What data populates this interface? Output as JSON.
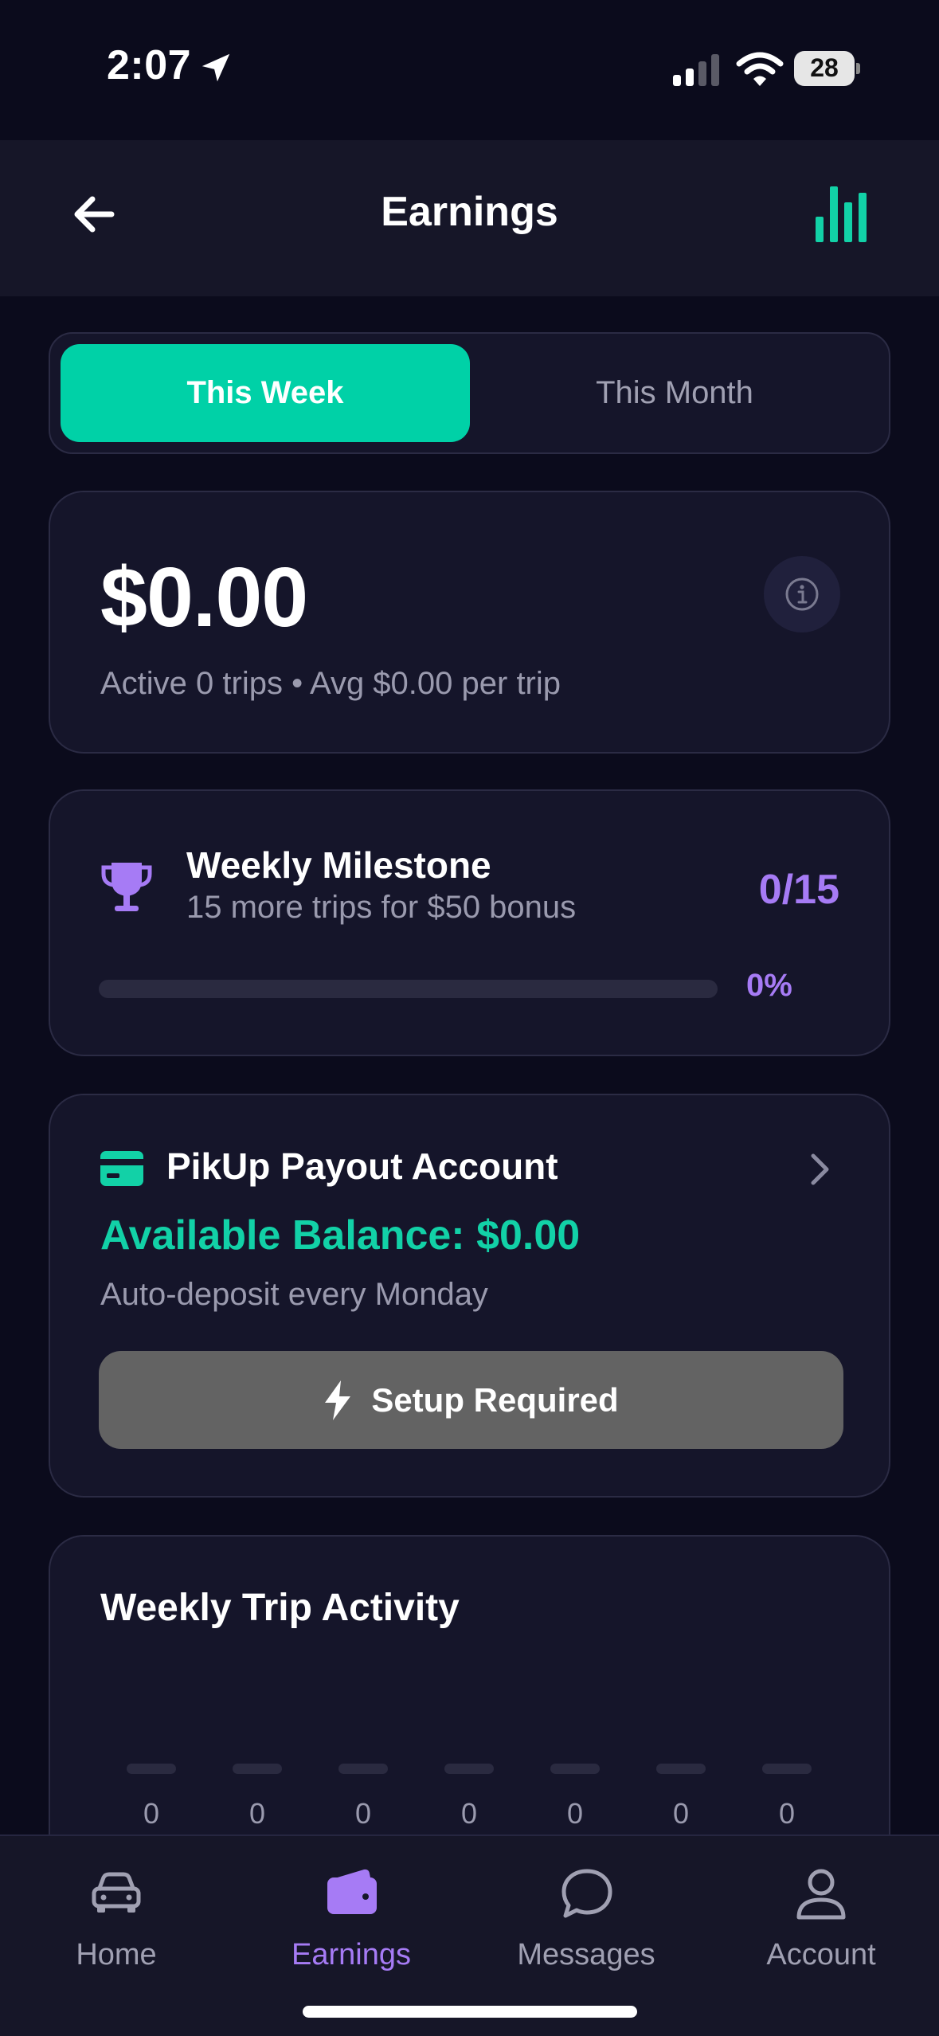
{
  "status_bar": {
    "time": "2:07",
    "battery": "28"
  },
  "header": {
    "title": "Earnings"
  },
  "segments": {
    "active": "This Week",
    "inactive": "This Month"
  },
  "summary": {
    "amount": "$0.00",
    "subtitle": "Active 0 trips • Avg $0.00 per trip"
  },
  "milestone": {
    "title": "Weekly Milestone",
    "subtitle": "15 more trips for $50 bonus",
    "count": "0/15",
    "percent_label": "0%",
    "progress": 0
  },
  "payout": {
    "title": "PikUp Payout Account",
    "balance": "Available Balance: $0.00",
    "deposit": "Auto-deposit every Monday",
    "button": "Setup Required"
  },
  "activity": {
    "title": "Weekly Trip Activity",
    "values": [
      "0",
      "0",
      "0",
      "0",
      "0",
      "0",
      "0"
    ]
  },
  "tabs": [
    {
      "label": "Home",
      "icon": "car-icon"
    },
    {
      "label": "Earnings",
      "icon": "wallet-icon"
    },
    {
      "label": "Messages",
      "icon": "chat-bubble-icon"
    },
    {
      "label": "Account",
      "icon": "person-icon"
    }
  ],
  "colors": {
    "accent_green": "#00d1a7",
    "accent_purple": "#a67bf5",
    "background": "#0b0b1c",
    "card": "#15152a"
  }
}
